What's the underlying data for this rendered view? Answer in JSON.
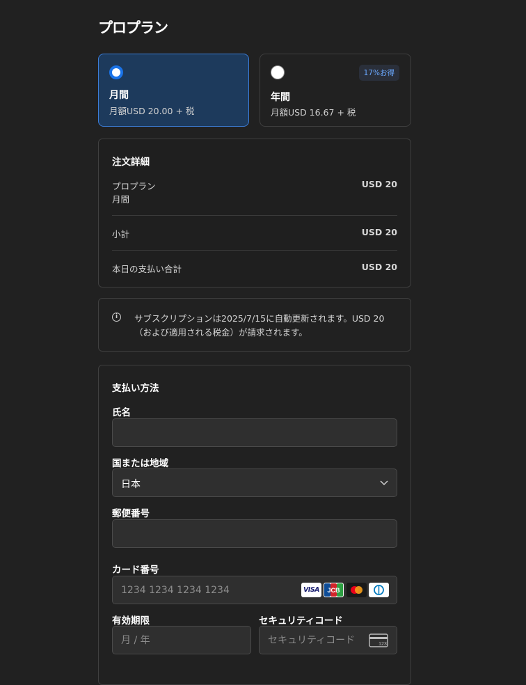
{
  "page": {
    "title": "プロプラン"
  },
  "plans": {
    "monthly": {
      "name": "月間",
      "price": "月額USD 20.00 + 税"
    },
    "yearly": {
      "name": "年間",
      "price": "月額USD 16.67 + 税",
      "badge": "17%お得"
    }
  },
  "order": {
    "title": "注文詳細",
    "item_name": "プロプラン",
    "item_period": "月間",
    "item_amount": "USD 20",
    "subtotal_label": "小計",
    "subtotal_amount": "USD 20",
    "total_label": "本日の支払い合計",
    "total_amount": "USD 20"
  },
  "notice": {
    "icon": "info-icon",
    "text": "サブスクリプションは2025/7/15に自動更新されます。USD 20（および適用される税金）が請求されます。"
  },
  "payment": {
    "title": "支払い方法",
    "name_label": "氏名",
    "name_value": "",
    "country_label": "国または地域",
    "country_value": "日本",
    "postal_label": "郵便番号",
    "postal_value": "",
    "card_label": "カード番号",
    "card_placeholder": "1234 1234 1234 1234",
    "card_brands": {
      "visa": "VISA",
      "jcb": "JCB",
      "mastercard": "mastercard-icon",
      "diners": "diners-icon"
    },
    "expiry_label": "有効期限",
    "expiry_placeholder": "月 / 年",
    "cvc_label": "セキュリティコード",
    "cvc_placeholder": "セキュリティコード",
    "cvc_icon_text": "123"
  },
  "colors": {
    "background": "#212121",
    "accent": "#1a73e8",
    "selected_plan_bg": "#1d3a5c",
    "badge_text": "#6aa8ff"
  }
}
